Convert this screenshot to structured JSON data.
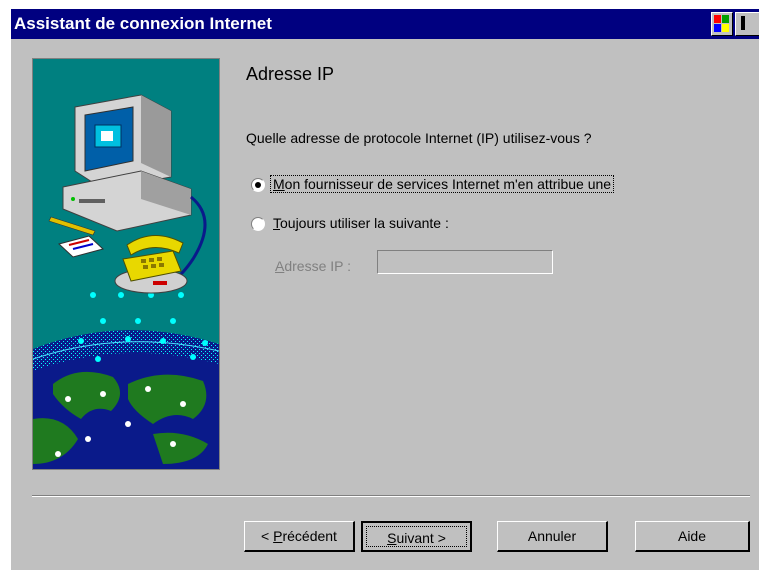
{
  "window": {
    "title": "Assistant de connexion Internet",
    "title_bar_color": "#000080",
    "face_color": "#c0c0c0"
  },
  "page": {
    "heading": "Adresse IP",
    "question": "Quelle adresse de protocole Internet (IP) utilisez-vous ?"
  },
  "options": {
    "auto": {
      "mnemonic": "M",
      "rest": "on fournisseur de services Internet m'en attribue une",
      "selected": true
    },
    "manual": {
      "mnemonic": "T",
      "rest": "oujours utiliser la suivante :",
      "selected": false
    }
  },
  "ip_field": {
    "label_mnemonic": "A",
    "label_before": "",
    "label_after": "dresse IP :",
    "value": "",
    "enabled": false
  },
  "buttons": {
    "prev_prefix": "< ",
    "prev_mnemonic": "P",
    "prev_rest": "récédent",
    "next_mnemonic": "S",
    "next_rest": "uivant >",
    "cancel": "Annuler",
    "help": "Aide"
  },
  "illustration": {
    "icons": [
      "computer-monitor-icon",
      "telephone-icon",
      "globe-icon",
      "pencil-icon",
      "notepad-icon"
    ],
    "sea_color": "#008080",
    "land_color": "#1f7a1f"
  }
}
